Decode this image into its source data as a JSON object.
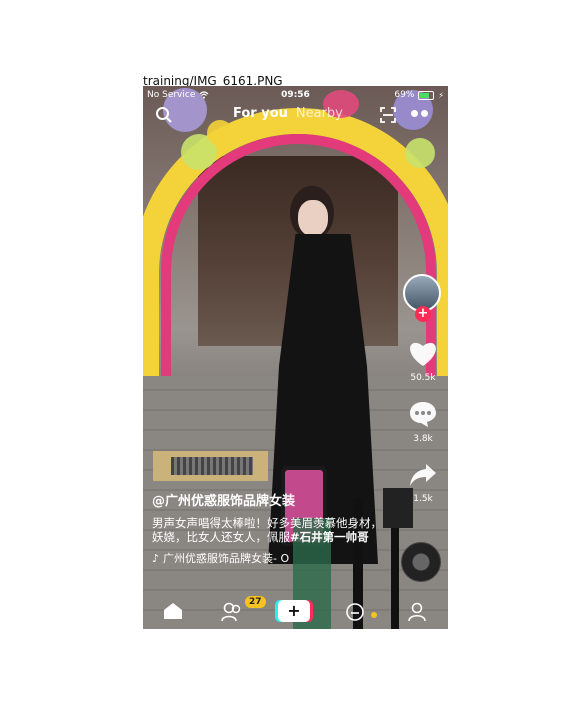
{
  "caption": "training/IMG_6161.PNG",
  "status_bar": {
    "carrier": "No Service",
    "time": "09:56",
    "battery": "69%",
    "battery_level": 0.69
  },
  "top_nav": {
    "tabs": [
      {
        "label": "For you",
        "active": true
      },
      {
        "label": "Nearby",
        "active": false
      }
    ]
  },
  "video": {
    "likes": "50.5k",
    "comments": "3.8k",
    "shares": "1.5k",
    "username": "@广州优惑服饰品牌女装",
    "description_plain": "男声女声唱得太棒啦！好多美眉羡慕他身材，妖娆，比女人还女人，佩服",
    "description_tag": "#石井第一帅哥",
    "music": "广州优惑服饰品牌女装- O"
  },
  "bottom_bar": {
    "friends_badge": "27"
  },
  "colors": {
    "accent_red": "#fe2c55",
    "accent_cyan": "#25f4ee",
    "badge_yellow": "#f7c31e"
  }
}
